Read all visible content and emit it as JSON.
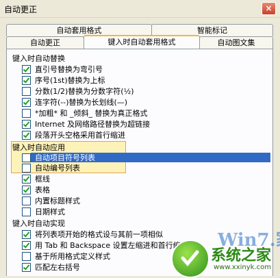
{
  "window": {
    "title": "自动更正",
    "close_glyph": "×"
  },
  "tabs_back": [
    "自动套用格式",
    "智能标记"
  ],
  "tabs_front": [
    "自动更正",
    "键入时自动套用格式",
    "自动图文集"
  ],
  "groups": [
    {
      "label": "键入时自动替换",
      "items": [
        {
          "label": "直引号替换为弯引号",
          "checked": true
        },
        {
          "label": "序号(1st)替换为上标",
          "checked": true
        },
        {
          "label": "分数(1/2)替换为分数字符(½)",
          "checked": false
        },
        {
          "label": "连字符(--)替换为长划线(—)",
          "checked": true
        },
        {
          "label": "*加粗* 和 _倾斜_ 替换为真正格式",
          "checked": false
        },
        {
          "label": "Internet 及网络路径替换为超链接",
          "checked": true
        },
        {
          "label": "段落开头空格采用首行缩进",
          "checked": true
        }
      ]
    },
    {
      "label": "键入时自动应用",
      "items": [
        {
          "label": "自动项目符号列表",
          "checked": false
        },
        {
          "label": "自动编号列表",
          "checked": false
        },
        {
          "label": "框线",
          "checked": true
        },
        {
          "label": "表格",
          "checked": true
        },
        {
          "label": "内置标题样式",
          "checked": false
        },
        {
          "label": "日期样式",
          "checked": false
        }
      ]
    },
    {
      "label": "键入时自动实现",
      "items": [
        {
          "label": "将列表项开始的格式设与其前一项相似",
          "checked": true
        },
        {
          "label": "用 Tab 和 Backspace 设置左缩进和首行缩进",
          "checked": true
        },
        {
          "label": "基于所用格式定义样式",
          "checked": false
        },
        {
          "label": "匹配左右括号",
          "checked": true
        }
      ]
    }
  ],
  "watermark": {
    "text": "Win7.家",
    "brand": "系统之家",
    "url": "www.xxinyk.com"
  }
}
